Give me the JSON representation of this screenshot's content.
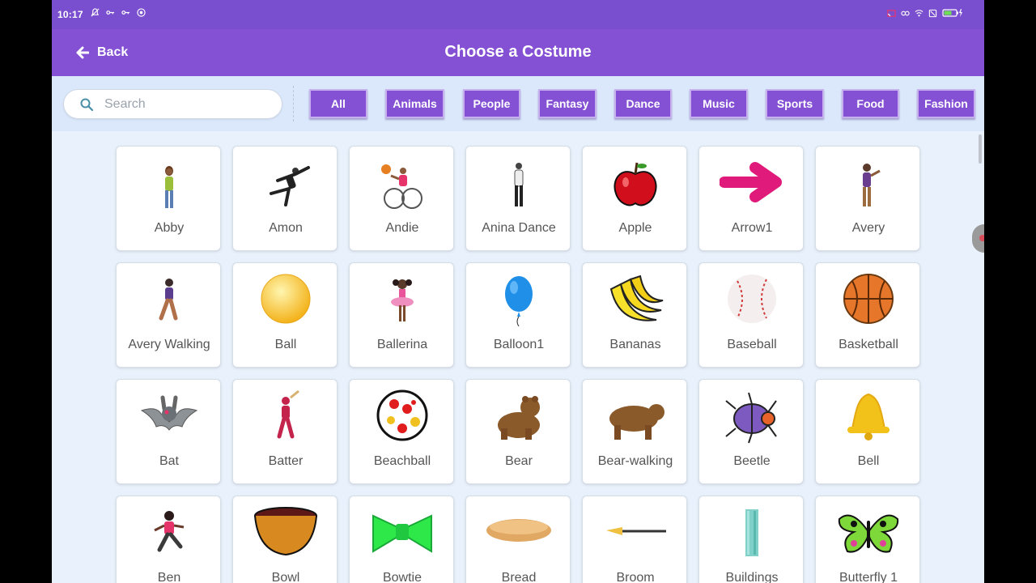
{
  "status_bar": {
    "time": "10:17",
    "left_icons": [
      "alarm-off-icon",
      "key-icon",
      "key-icon",
      "app-icon"
    ],
    "right_icons": [
      "cast-icon",
      "vpn-icon",
      "wifi-icon",
      "sim-off-icon",
      "battery-charging-icon"
    ]
  },
  "header": {
    "back_label": "Back",
    "title": "Choose a Costume"
  },
  "search": {
    "placeholder": "Search",
    "value": ""
  },
  "categories": [
    "All",
    "Animals",
    "People",
    "Fantasy",
    "Dance",
    "Music",
    "Sports",
    "Food",
    "Fashion"
  ],
  "costumes": [
    {
      "name": "Abby",
      "icon": "girl-standing-icon"
    },
    {
      "name": "Amon",
      "icon": "dancer-pose-icon"
    },
    {
      "name": "Andie",
      "icon": "wheelchair-basketball-icon"
    },
    {
      "name": "Anina Dance",
      "icon": "dancer-standing-icon"
    },
    {
      "name": "Apple",
      "icon": "apple-icon"
    },
    {
      "name": "Arrow1",
      "icon": "arrow-right-icon"
    },
    {
      "name": "Avery",
      "icon": "girl-waving-icon"
    },
    {
      "name": "Avery Walking",
      "icon": "girl-walking-icon"
    },
    {
      "name": "Ball",
      "icon": "yellow-ball-icon"
    },
    {
      "name": "Ballerina",
      "icon": "ballerina-icon"
    },
    {
      "name": "Balloon1",
      "icon": "balloon-icon"
    },
    {
      "name": "Bananas",
      "icon": "bananas-icon"
    },
    {
      "name": "Baseball",
      "icon": "baseball-icon"
    },
    {
      "name": "Basketball",
      "icon": "basketball-icon"
    },
    {
      "name": "Bat",
      "icon": "bat-icon"
    },
    {
      "name": "Batter",
      "icon": "batter-icon"
    },
    {
      "name": "Beachball",
      "icon": "beachball-icon"
    },
    {
      "name": "Bear",
      "icon": "bear-icon"
    },
    {
      "name": "Bear-walking",
      "icon": "bear-walking-icon"
    },
    {
      "name": "Beetle",
      "icon": "beetle-icon"
    },
    {
      "name": "Bell",
      "icon": "bell-icon"
    },
    {
      "name": "Ben",
      "icon": "boy-running-icon"
    },
    {
      "name": "Bowl",
      "icon": "bowl-icon"
    },
    {
      "name": "Bowtie",
      "icon": "bowtie-icon"
    },
    {
      "name": "Bread",
      "icon": "bread-icon"
    },
    {
      "name": "Broom",
      "icon": "broom-icon"
    },
    {
      "name": "Buildings",
      "icon": "buildings-icon"
    },
    {
      "name": "Butterfly 1",
      "icon": "butterfly-icon"
    }
  ]
}
